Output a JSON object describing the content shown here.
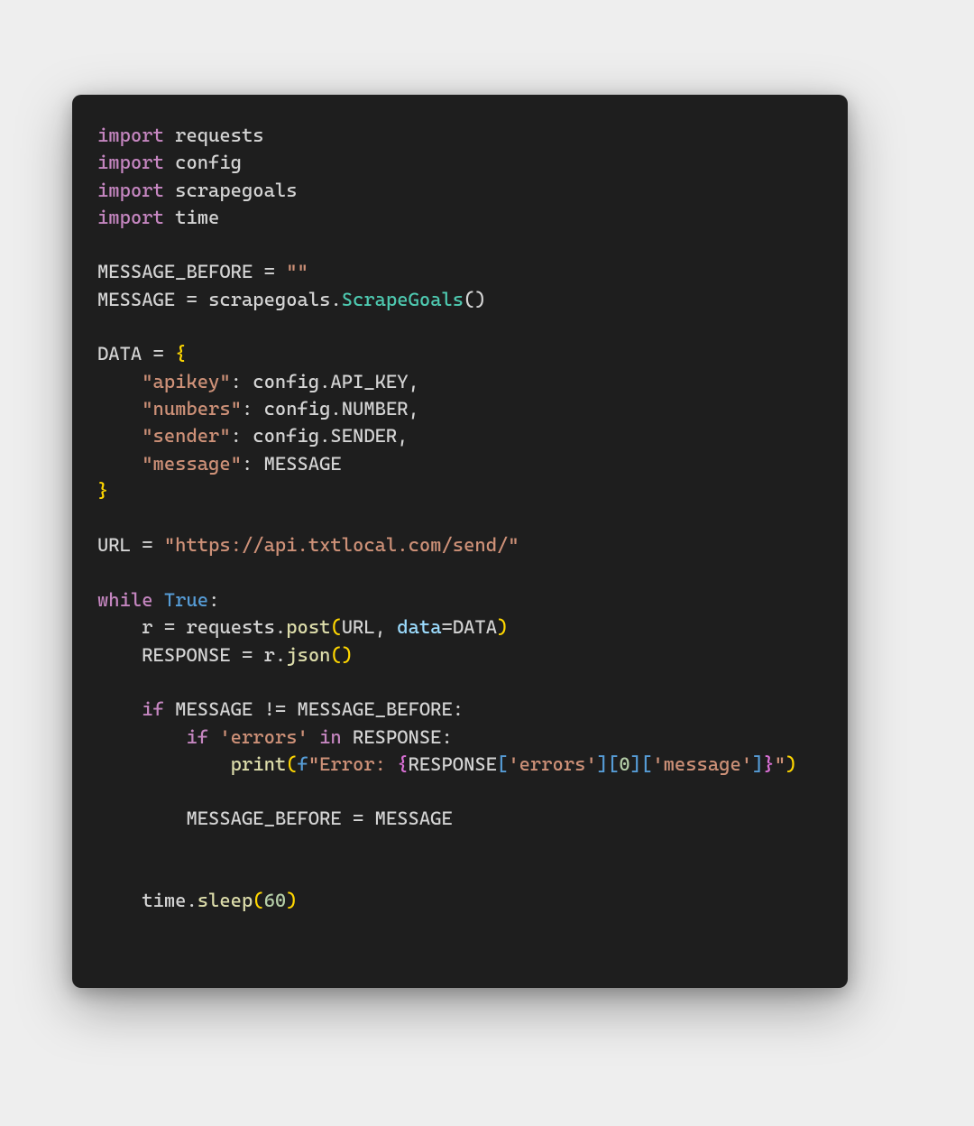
{
  "code": {
    "imports": [
      "requests",
      "config",
      "scrapegoals",
      "time"
    ],
    "kw_import": "import",
    "var_msg_before": "MESSAGE_BEFORE",
    "var_msg": "MESSAGE",
    "empty_str": "\"\"",
    "scrape_call_mod": "scrapegoals",
    "scrape_call_fn": "ScrapeGoals",
    "var_data": "DATA",
    "dict": {
      "k_api": "\"apikey\"",
      "v_api_mod": "config",
      "v_api_attr": "API_KEY",
      "k_num": "\"numbers\"",
      "v_num_mod": "config",
      "v_num_attr": "NUMBER",
      "k_send": "\"sender\"",
      "v_send_mod": "config",
      "v_send_attr": "SENDER",
      "k_msg": "\"message\"",
      "v_msg": "MESSAGE"
    },
    "var_url": "URL",
    "url_str": "\"https://api.txtlocal.com/send/\"",
    "kw_while": "while",
    "bool_true": "True",
    "var_r": "r",
    "requests_mod": "requests",
    "post_fn": "post",
    "data_kw": "data",
    "var_response": "RESPONSE",
    "json_fn": "json",
    "kw_if": "if",
    "ne_op": "!=",
    "errors_lit": "'errors'",
    "kw_in": "in",
    "print_fn": "print",
    "f_prefix": "f",
    "fstr_open": "\"Error: ",
    "fstr_close": "\"",
    "idx0": "0",
    "msg_lit": "'message'",
    "assign_back_lhs": "MESSAGE_BEFORE",
    "assign_back_rhs": "MESSAGE",
    "time_mod": "time",
    "sleep_fn": "sleep",
    "sleep_arg": "60"
  }
}
